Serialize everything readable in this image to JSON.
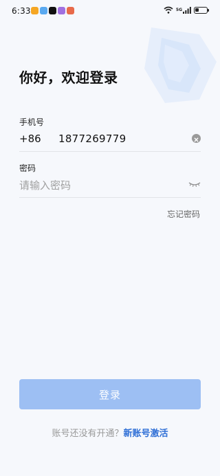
{
  "status_bar": {
    "time": "6:33",
    "network_label": "5G",
    "app_icons": [
      {
        "name": "orange-app-icon",
        "color": "#f5a623"
      },
      {
        "name": "blue-app-icon",
        "color": "#5aa9f0"
      },
      {
        "name": "tiktok-icon",
        "color": "#111111"
      },
      {
        "name": "purple-app-icon",
        "color": "#a070e0"
      },
      {
        "name": "red-app-icon",
        "color": "#e86a4a"
      }
    ],
    "battery_level": 0.35
  },
  "login": {
    "title": "你好，欢迎登录",
    "phone_label": "手机号",
    "country_code": "+86",
    "phone_value": "1877269779",
    "password_label": "密码",
    "password_placeholder": "请输入密码",
    "forgot_password": "忘记密码",
    "login_button": "登录",
    "no_account_prompt": "账号还没有开通？",
    "activate_link": "新账号激活"
  },
  "colors": {
    "login_button_bg": "#9dbff3",
    "link": "#2f6fd6",
    "background": "#f6f8fc"
  }
}
